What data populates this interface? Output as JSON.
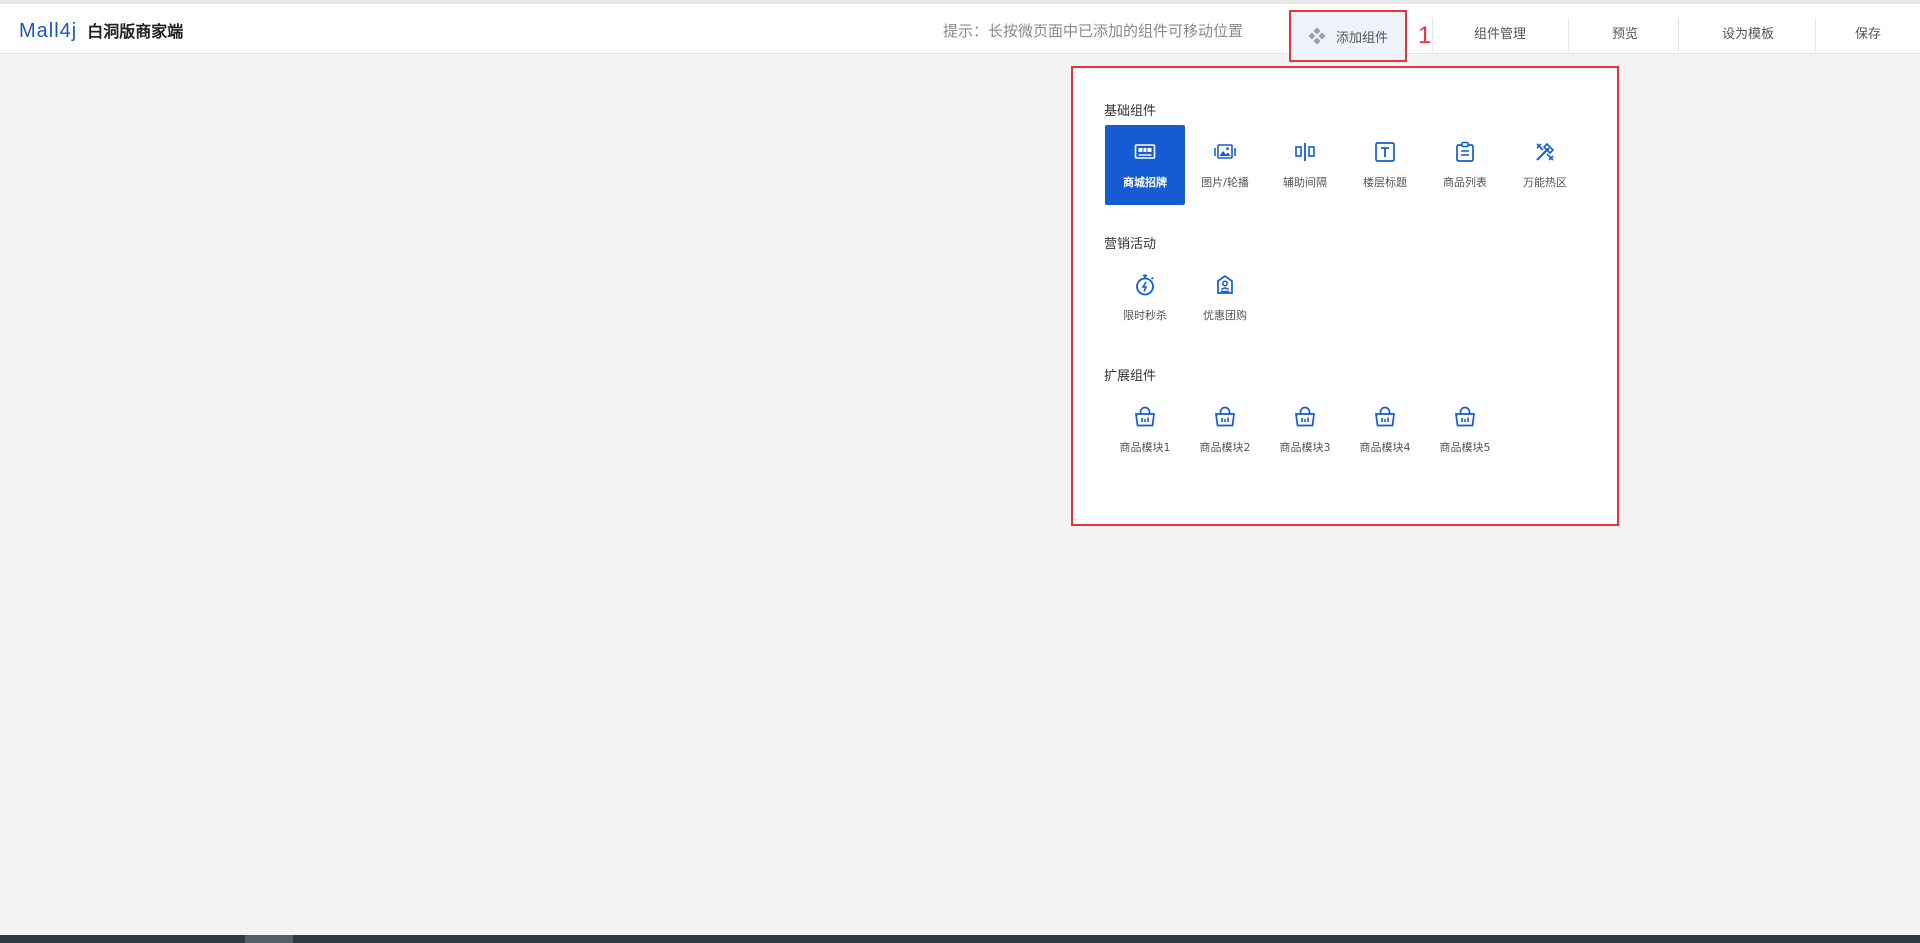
{
  "header": {
    "logo": "Mall4j",
    "subtitle": "白洞版商家端",
    "hint": "提示：长按微页面中已添加的组件可移动位置",
    "add_component": "添加组件",
    "annotation": "1",
    "nav": [
      "组件管理",
      "预览",
      "设为模板",
      "保存"
    ]
  },
  "panel": {
    "sections": [
      {
        "title": "基础组件",
        "items": [
          {
            "label": "商城招牌",
            "icon": "store-sign-icon",
            "active": true
          },
          {
            "label": "图片/轮播",
            "icon": "image-carousel-icon"
          },
          {
            "label": "辅助间隔",
            "icon": "spacer-icon"
          },
          {
            "label": "楼层标题",
            "icon": "text-title-icon"
          },
          {
            "label": "商品列表",
            "icon": "product-list-icon"
          },
          {
            "label": "万能热区",
            "icon": "hotspot-icon"
          }
        ]
      },
      {
        "title": "营销活动",
        "items": [
          {
            "label": "限时秒杀",
            "icon": "stopwatch-flash-icon"
          },
          {
            "label": "优惠团购",
            "icon": "group-buy-icon"
          }
        ]
      },
      {
        "title": "扩展组件",
        "items": [
          {
            "label": "商品模块1",
            "icon": "basket-icon"
          },
          {
            "label": "商品模块2",
            "icon": "basket-icon"
          },
          {
            "label": "商品模块3",
            "icon": "basket-icon"
          },
          {
            "label": "商品模块4",
            "icon": "basket-icon"
          },
          {
            "label": "商品模块5",
            "icon": "basket-icon"
          }
        ]
      }
    ]
  },
  "colors": {
    "accent": "#155bd4",
    "highlight": "#e8323c",
    "logo": "#1d56c6",
    "background": "#f3f3f3"
  }
}
